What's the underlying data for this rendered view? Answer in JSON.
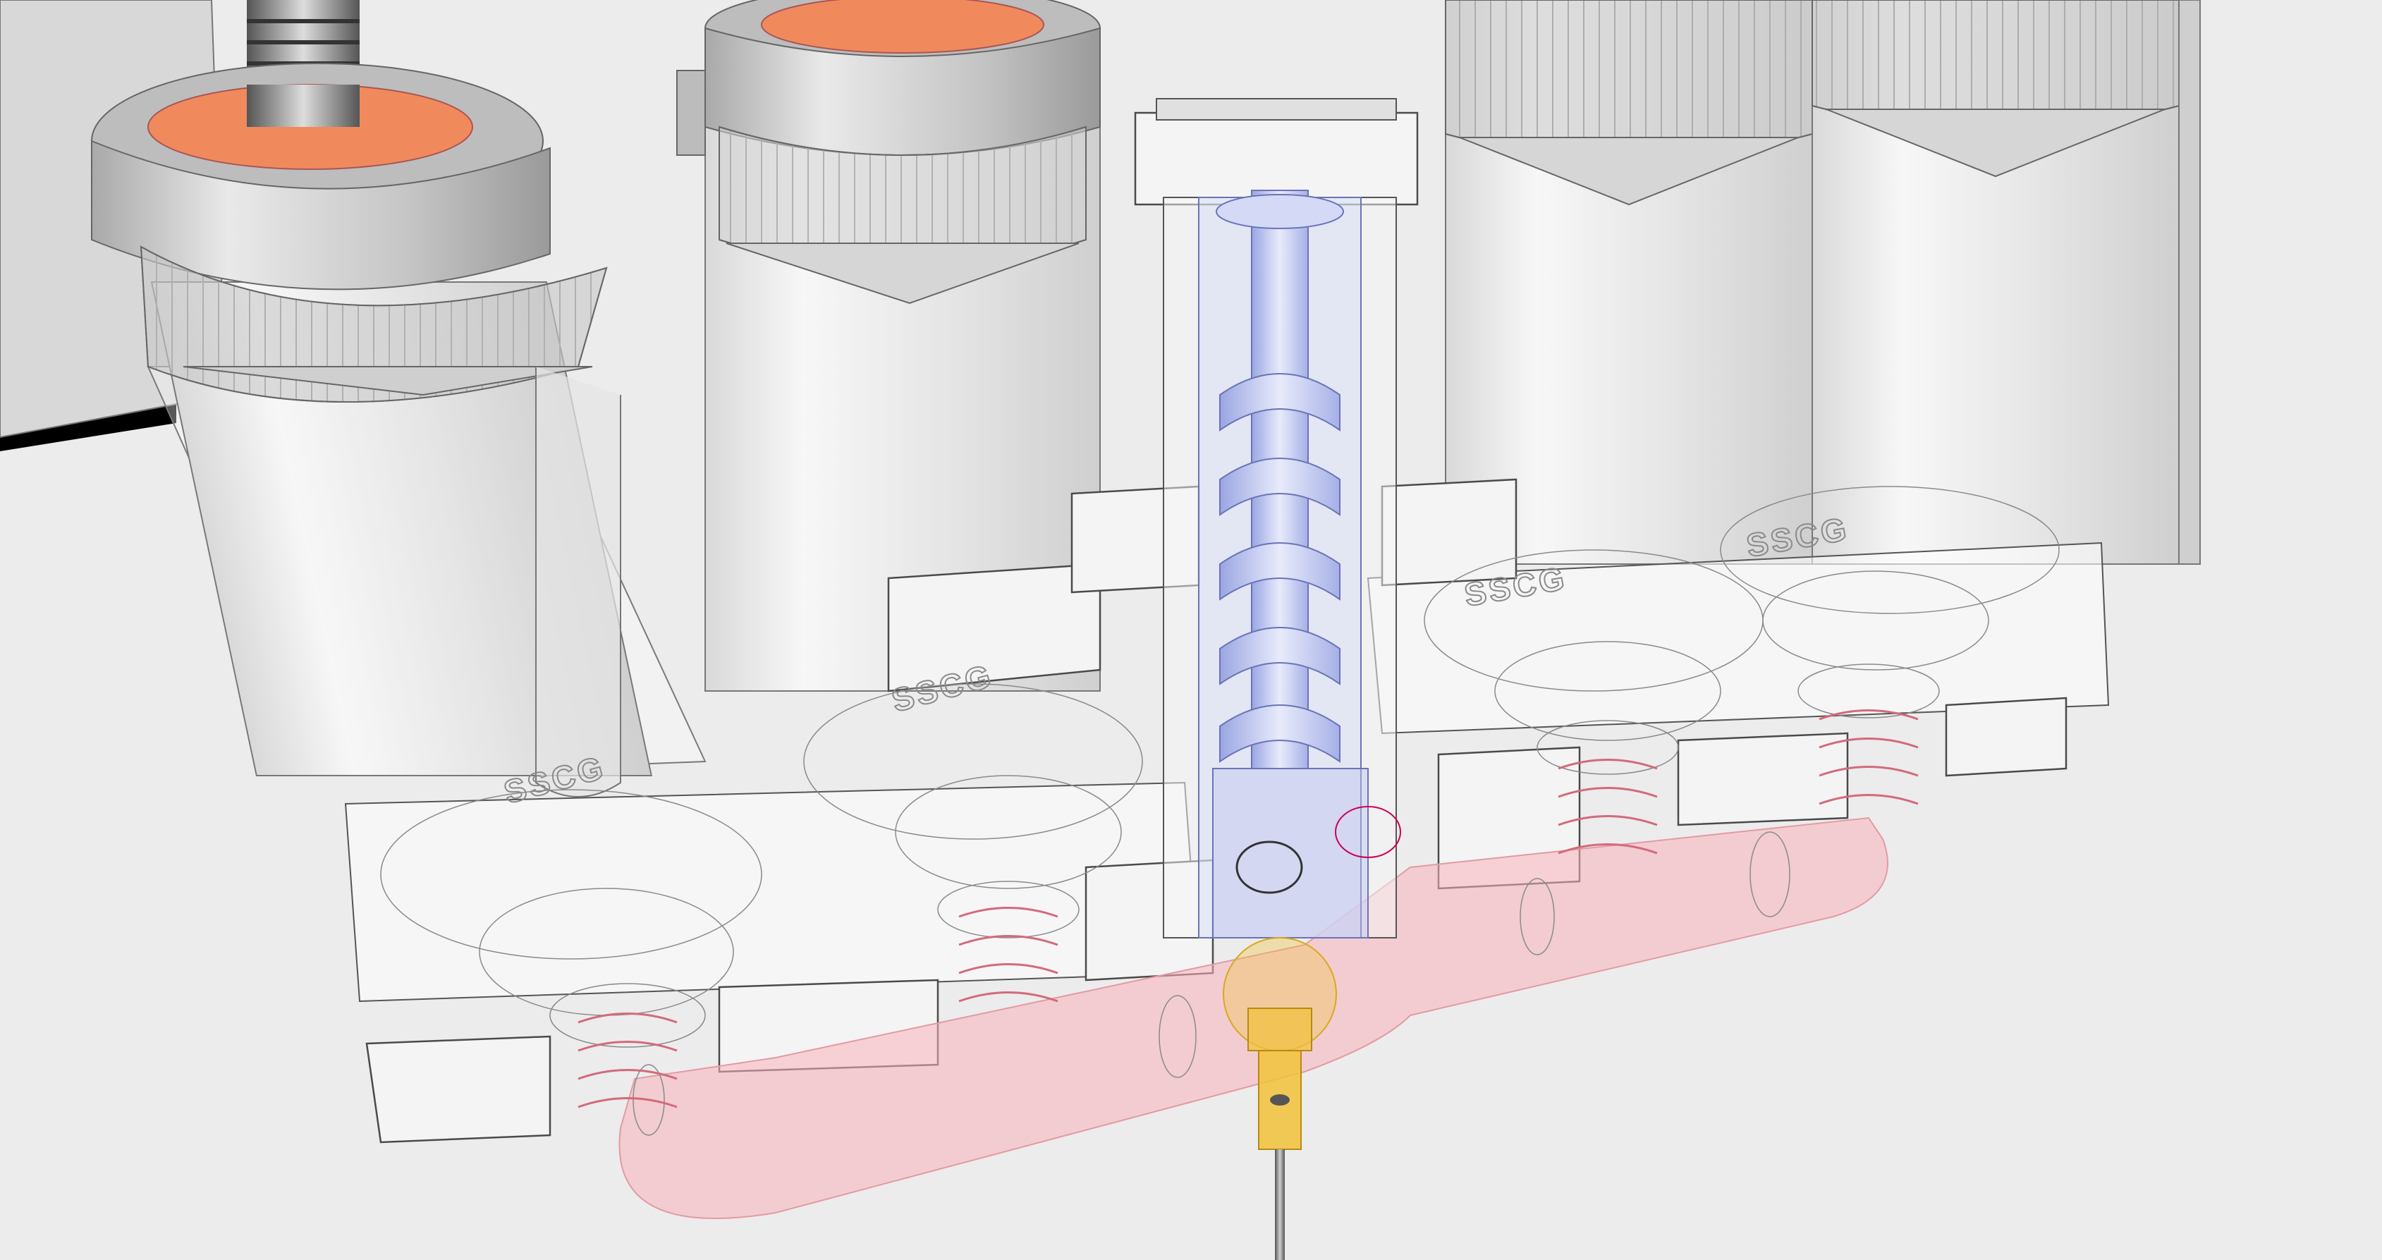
{
  "scene": {
    "background_color": "#ececec",
    "dark_corner_color": "#000000",
    "channel_color": "#f7b3bb",
    "auger_color": "#b9c2ee",
    "needle_hub_color": "#f2c23a",
    "cap_inner_color": "#f08a5d",
    "spring_color": "#d36a7a",
    "logo_text": "SSCG"
  }
}
